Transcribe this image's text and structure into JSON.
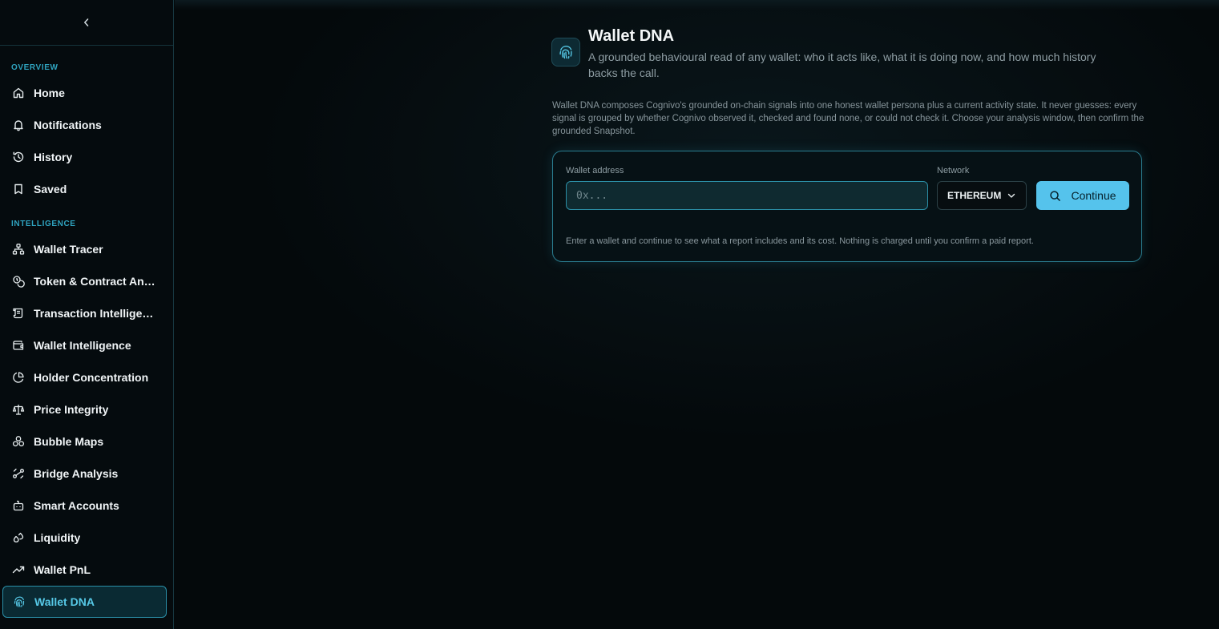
{
  "sidebar": {
    "collapse_icon": "chevron-left-icon",
    "sections": {
      "overview": "OVERVIEW",
      "intelligence": "INTELLIGENCE"
    },
    "overview_items": [
      {
        "label": "Home",
        "icon": "home-icon"
      },
      {
        "label": "Notifications",
        "icon": "bell-icon"
      },
      {
        "label": "History",
        "icon": "history-icon"
      },
      {
        "label": "Saved",
        "icon": "bookmark-icon"
      }
    ],
    "intelligence_items": [
      {
        "label": "Wallet Tracer",
        "icon": "network-icon"
      },
      {
        "label": "Token & Contract Analysis",
        "icon": "coins-icon"
      },
      {
        "label": "Transaction Intelligence",
        "icon": "scroll-icon"
      },
      {
        "label": "Wallet Intelligence",
        "icon": "wallet-icon"
      },
      {
        "label": "Holder Concentration",
        "icon": "pie-chart-icon"
      },
      {
        "label": "Price Integrity",
        "icon": "scale-icon"
      },
      {
        "label": "Bubble Maps",
        "icon": "bubbles-icon"
      },
      {
        "label": "Bridge Analysis",
        "icon": "bridge-icon"
      },
      {
        "label": "Smart Accounts",
        "icon": "bot-icon"
      },
      {
        "label": "Liquidity",
        "icon": "droplets-icon"
      },
      {
        "label": "Wallet PnL",
        "icon": "trending-up-icon"
      },
      {
        "label": "Wallet DNA",
        "icon": "fingerprint-icon",
        "active": true
      }
    ]
  },
  "page": {
    "icon": "fingerprint-icon",
    "title": "Wallet DNA",
    "subtitle": "A grounded behavioural read of any wallet: who it acts like, what it is doing now, and how much history backs the call.",
    "description": "Wallet DNA composes Cognivo's grounded on-chain signals into one honest wallet persona plus a current activity state. It never guesses: every signal is grouped by whether Cognivo observed it, checked and found none, or could not check it. Choose your analysis window, then confirm the grounded Snapshot."
  },
  "form": {
    "wallet_label": "Wallet address",
    "wallet_placeholder": "0x...",
    "wallet_value": "",
    "network_label": "Network",
    "network_value": "ETHEREUM",
    "continue_label": "Continue",
    "hint": "Enter a wallet and continue to see what a report includes and its cost. Nothing is charged until you confirm a paid report."
  },
  "colors": {
    "accent": "#55c3ec",
    "active_text": "#56c8e6",
    "section_label": "#2fa3bf",
    "border": "#2a7d90"
  }
}
